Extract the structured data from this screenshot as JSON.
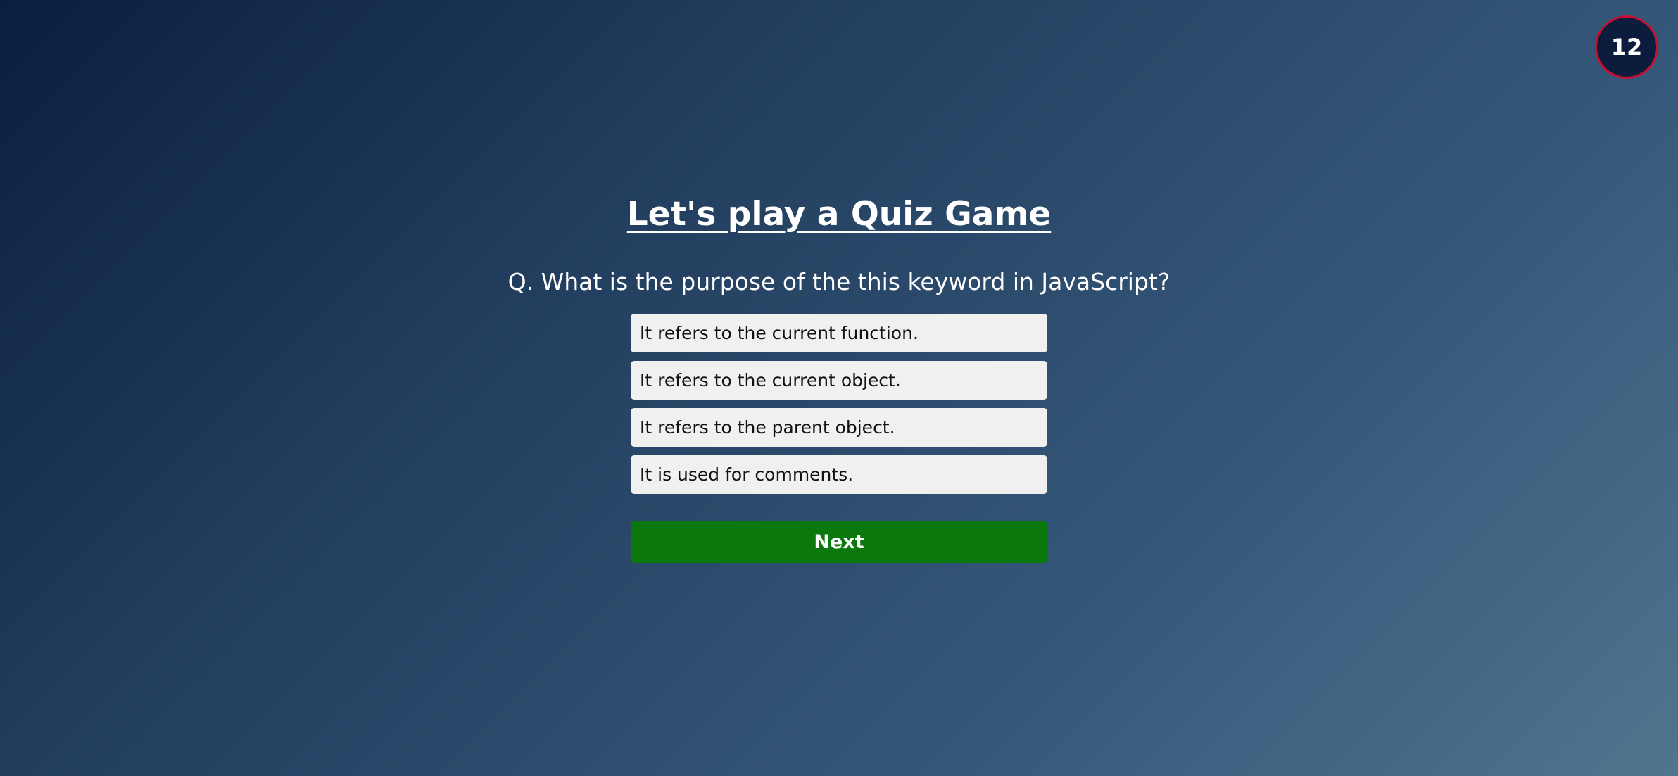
{
  "timer": {
    "value": "12"
  },
  "quiz": {
    "title": "Let's play a Quiz Game",
    "question": "Q. What is the purpose of the this keyword in JavaScript?",
    "answers": [
      "It refers to the current function.",
      "It refers to the current object.",
      "It refers to the parent object.",
      "It is used for comments."
    ],
    "next_label": "Next"
  },
  "colors": {
    "background_start": "#0b1f40",
    "background_end": "#4f758e",
    "timer_bg": "#0c1c3d",
    "timer_border": "#c8102e",
    "answer_bg": "#f0f0f0",
    "next_bg": "#0a780d"
  }
}
